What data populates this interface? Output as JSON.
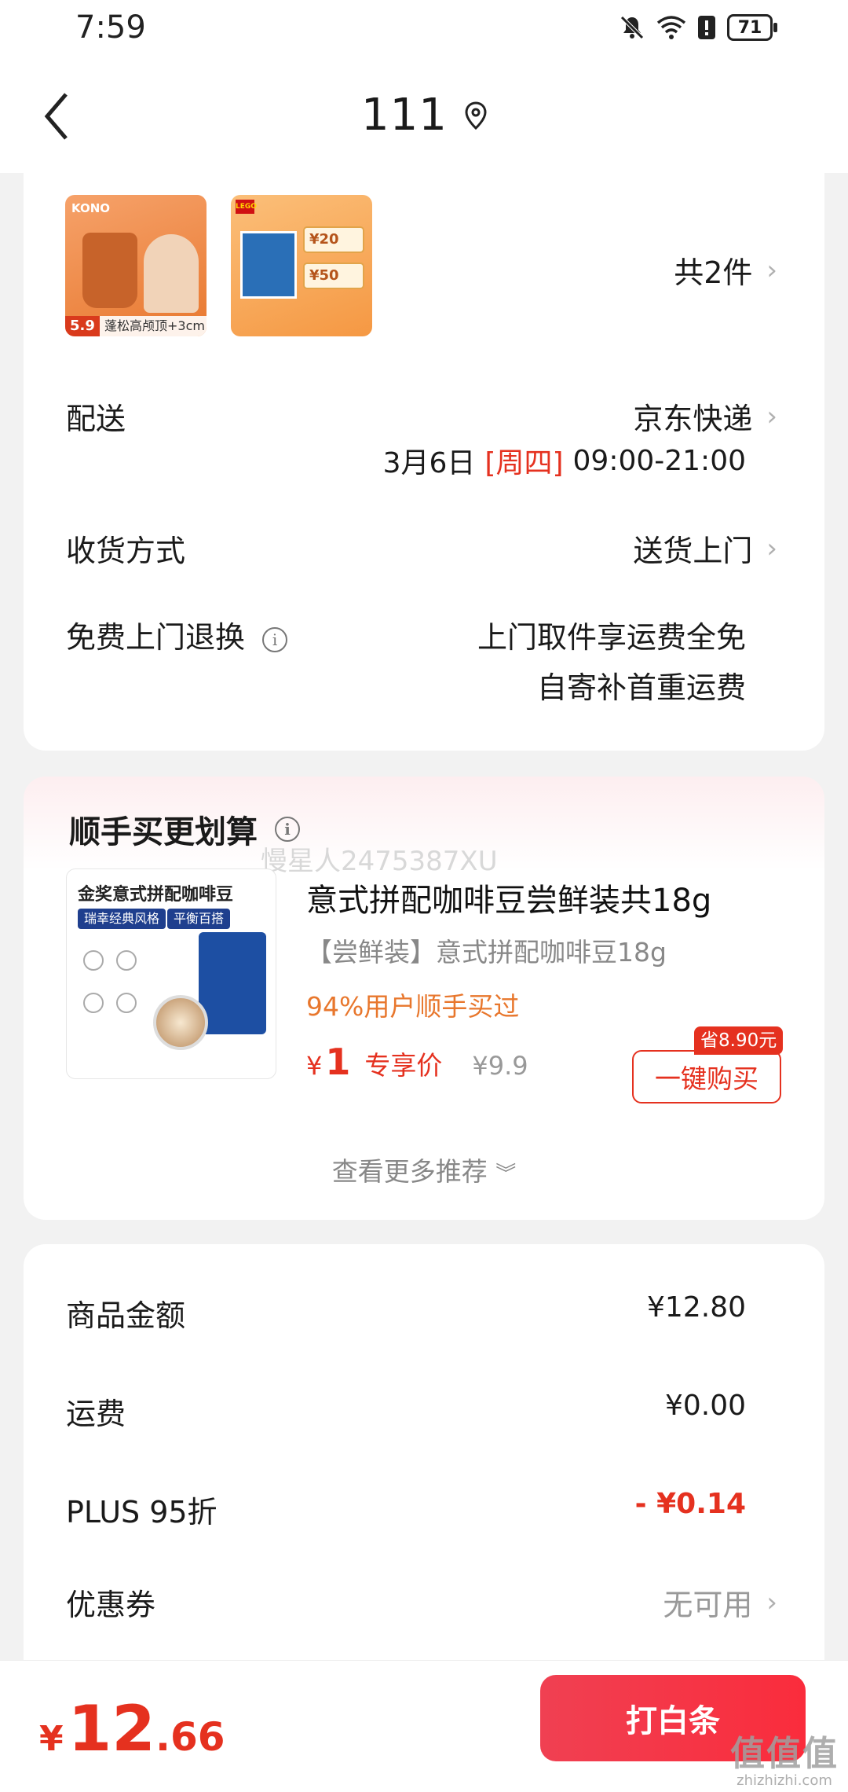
{
  "status_bar": {
    "time": "7:59",
    "battery": "71"
  },
  "header": {
    "title": "111"
  },
  "order": {
    "thumb1": {
      "brand": "KONO",
      "caption": "蓬松高颅顶+3cm",
      "price": "5.9"
    },
    "thumb2": {
      "brand": "LEGO",
      "coupon1": "¥20",
      "coupon2": "¥50"
    },
    "item_count": "共2件",
    "delivery_label": "配送",
    "delivery_value": "京东快递",
    "delivery_date": "3月6日",
    "delivery_weekday": "[周四]",
    "delivery_time": "09:00-21:00",
    "receive_label": "收货方式",
    "receive_value": "送货上门",
    "return_label": "免费上门退换",
    "return_value1": "上门取件享运费全免",
    "return_value2": "自寄补首重运费"
  },
  "recommend": {
    "title": "顺手买更划算",
    "watermark": "慢星人2475387XU",
    "image": {
      "title": "金奖意式拼配咖啡豆",
      "tag1": "瑞幸经典风格",
      "tag2": "平衡百搭"
    },
    "name": "意式拼配咖啡豆尝鲜装共18g",
    "subtitle": "【尝鲜装】意式拼配咖啡豆18g",
    "sold": "94%用户顺手买过",
    "currency": "¥",
    "price": "1",
    "price_label": "专享价",
    "original_price": "¥9.9",
    "save_badge": "省8.90元",
    "buy_button": "一键购买",
    "more": "查看更多推荐"
  },
  "summary": {
    "goods_label": "商品金额",
    "goods_value": "¥12.80",
    "shipping_label": "运费",
    "shipping_value": "¥0.00",
    "plus_label": "PLUS 95折",
    "plus_value": "- ¥0.14",
    "coupon_label": "优惠券",
    "coupon_value": "无可用"
  },
  "bottom": {
    "currency": "¥",
    "total_int": "12",
    "total_dec": ".66",
    "pay_button": "打白条",
    "watermark": "值值值",
    "watermark_url": "zhizhizhi.com"
  },
  "colors": {
    "accent": "#e5311f",
    "pay_button": "#f23a4a",
    "orange_text": "#e8772d"
  }
}
